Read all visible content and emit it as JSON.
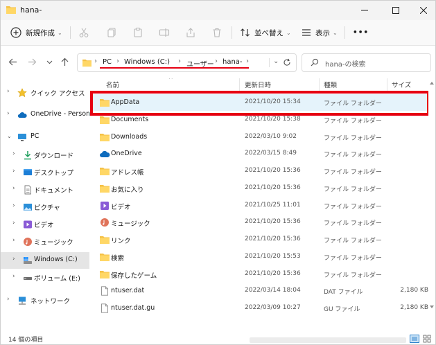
{
  "window": {
    "title": "hana-",
    "colors": {
      "accent": "#0067c0",
      "highlight": "#e5f3fb",
      "annotation": "#e60012",
      "folder": "#f5c146"
    }
  },
  "toolbar": {
    "new_label": "新規作成",
    "sort_label": "並べ替え",
    "view_label": "表示",
    "more_label": "•••"
  },
  "address": {
    "crumbs": [
      "PC",
      "Windows (C:)",
      "ユーザー",
      "hana-"
    ],
    "search_placeholder": "hana-の検索"
  },
  "nav": {
    "items": [
      {
        "label": "クイック アクセス",
        "icon": "star-icon"
      },
      {
        "label": "OneDrive - Personal",
        "icon": "cloud-icon"
      },
      {
        "label": "PC",
        "icon": "monitor-icon"
      },
      {
        "label": "ダウンロード",
        "icon": "download-icon"
      },
      {
        "label": "デスクトップ",
        "icon": "desktop-icon"
      },
      {
        "label": "ドキュメント",
        "icon": "document-icon"
      },
      {
        "label": "ピクチャ",
        "icon": "picture-icon"
      },
      {
        "label": "ビデオ",
        "icon": "video-icon"
      },
      {
        "label": "ミュージック",
        "icon": "music-icon"
      },
      {
        "label": "Windows (C:)",
        "icon": "drive-icon"
      },
      {
        "label": "ボリューム (E:)",
        "icon": "drive-icon"
      },
      {
        "label": "ネットワーク",
        "icon": "network-icon"
      }
    ]
  },
  "columns": {
    "name": "名前",
    "date": "更新日時",
    "type": "種類",
    "size": "サイズ"
  },
  "files": [
    {
      "name": "AppData",
      "date": "2021/10/20 15:34",
      "type": "ファイル フォルダー",
      "size": "",
      "icon": "folder-icon"
    },
    {
      "name": "Documents",
      "date": "2021/10/20 15:38",
      "type": "ファイル フォルダー",
      "size": "",
      "icon": "folder-icon"
    },
    {
      "name": "Downloads",
      "date": "2022/03/10 9:02",
      "type": "ファイル フォルダー",
      "size": "",
      "icon": "folder-icon"
    },
    {
      "name": "OneDrive",
      "date": "2022/03/15 8:49",
      "type": "ファイル フォルダー",
      "size": "",
      "icon": "cloud-icon"
    },
    {
      "name": "アドレス帳",
      "date": "2021/10/20 15:36",
      "type": "ファイル フォルダー",
      "size": "",
      "icon": "folder-icon"
    },
    {
      "name": "お気に入り",
      "date": "2021/10/20 15:36",
      "type": "ファイル フォルダー",
      "size": "",
      "icon": "folder-icon"
    },
    {
      "name": "ビデオ",
      "date": "2021/10/25 11:01",
      "type": "ファイル フォルダー",
      "size": "",
      "icon": "video-icon"
    },
    {
      "name": "ミュージック",
      "date": "2021/10/20 15:36",
      "type": "ファイル フォルダー",
      "size": "",
      "icon": "music-icon"
    },
    {
      "name": "リンク",
      "date": "2021/10/20 15:36",
      "type": "ファイル フォルダー",
      "size": "",
      "icon": "folder-icon"
    },
    {
      "name": "検索",
      "date": "2021/10/20 15:53",
      "type": "ファイル フォルダー",
      "size": "",
      "icon": "folder-icon"
    },
    {
      "name": "保存したゲーム",
      "date": "2021/10/20 15:36",
      "type": "ファイル フォルダー",
      "size": "",
      "icon": "folder-icon"
    },
    {
      "name": "ntuser.dat",
      "date": "2022/03/14 18:04",
      "type": "DAT ファイル",
      "size": "2,180 KB",
      "icon": "file-icon"
    },
    {
      "name": "ntuser.dat.gu",
      "date": "2022/03/09 10:27",
      "type": "GU ファイル",
      "size": "2,180 KB",
      "icon": "file-icon"
    }
  ],
  "status": {
    "item_count": "14 個の項目"
  }
}
